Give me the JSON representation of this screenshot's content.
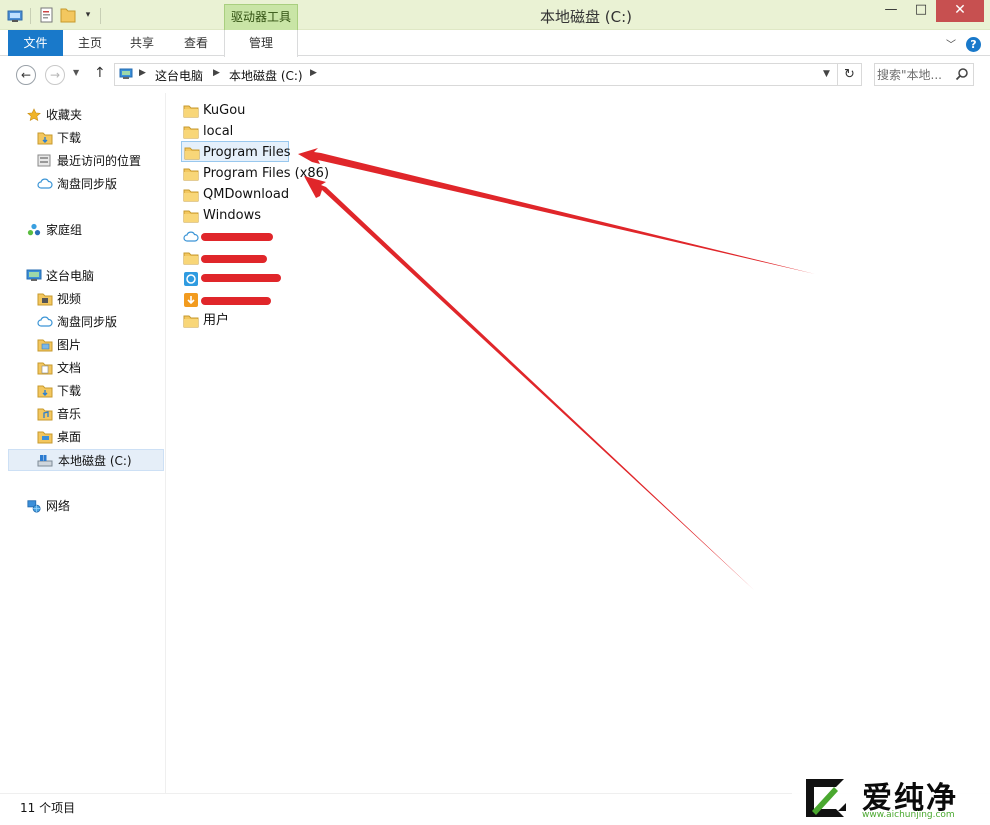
{
  "window": {
    "title": "本地磁盘 (C:)",
    "context_tab_label": "驱动器工具",
    "minimize": "—",
    "maximize": "□",
    "close": "✕"
  },
  "ribbon": {
    "tabs": [
      {
        "label": "文件"
      },
      {
        "label": "主页"
      },
      {
        "label": "共享"
      },
      {
        "label": "查看"
      },
      {
        "label": "管理"
      }
    ],
    "help": "?"
  },
  "address": {
    "crumbs": [
      "这台电脑",
      "本地磁盘 (C:)"
    ],
    "search_placeholder": "搜索\"本地...",
    "back_glyph": "←",
    "forward_glyph": "→",
    "up_glyph": "↑",
    "refresh_glyph": "↻"
  },
  "nav": {
    "favorites": {
      "label": "收藏夹",
      "items": [
        "下载",
        "最近访问的位置",
        "淘盘同步版"
      ]
    },
    "homegroup": {
      "label": "家庭组"
    },
    "this_pc": {
      "label": "这台电脑",
      "items": [
        "视频",
        "淘盘同步版",
        "图片",
        "文档",
        "下载",
        "音乐",
        "桌面",
        "本地磁盘 (C:)"
      ]
    },
    "network": {
      "label": "网络"
    }
  },
  "files": [
    {
      "name": "KuGou",
      "icon": "folder-icon"
    },
    {
      "name": "local",
      "icon": "folder-icon"
    },
    {
      "name": "Program Files",
      "icon": "folder-icon",
      "selected": true
    },
    {
      "name": "Program Files (x86)",
      "icon": "folder-icon"
    },
    {
      "name": "QMDownload",
      "icon": "folder-icon"
    },
    {
      "name": "Windows",
      "icon": "folder-icon"
    },
    {
      "name": "",
      "icon": "cloud-icon",
      "redacted": true
    },
    {
      "name": "",
      "icon": "folder-icon",
      "redacted": true
    },
    {
      "name": "",
      "icon": "sync-app-icon",
      "redacted": true
    },
    {
      "name": "",
      "icon": "download-app-icon",
      "redacted": true
    },
    {
      "name": "用户",
      "icon": "folder-icon"
    }
  ],
  "status": {
    "count": "11 个项目"
  },
  "watermark": {
    "text": "爱纯净",
    "url": "www.aichunjing.com"
  },
  "colors": {
    "accent": "#1979ca",
    "annotation": "#e0262a",
    "context_tab": "#c9e5a6"
  }
}
